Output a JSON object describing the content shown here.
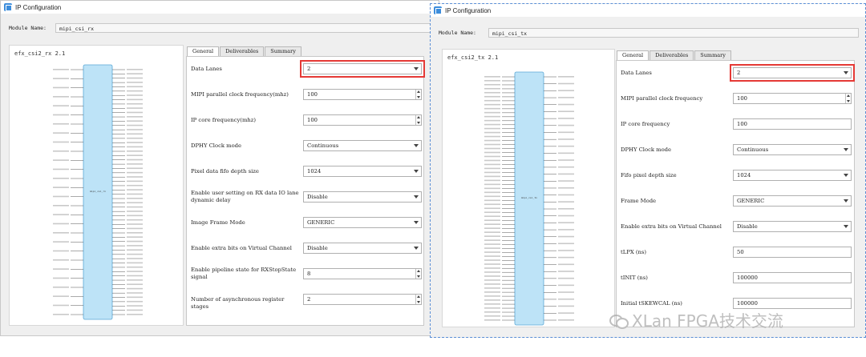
{
  "left": {
    "title": "IP Configuration",
    "module_name_label": "Module Name:",
    "module_name_value": "mipi_csi_rx",
    "symbol_title": "efx_csi2_rx 2.1",
    "block_label": "mipi_csi_rx",
    "tabs": [
      "General",
      "Deliverables",
      "Summary"
    ],
    "params": [
      {
        "label": "Data Lanes",
        "value": "2",
        "kind": "combo",
        "highlight": true
      },
      {
        "label": "MIPI parallel clock frequency(mhz)",
        "value": "100",
        "kind": "spin"
      },
      {
        "label": "IP core frequency(mhz)",
        "value": "100",
        "kind": "spin"
      },
      {
        "label": "DPHY Clock mode",
        "value": "Continuous",
        "kind": "combo"
      },
      {
        "label": "Pixel data fifo depth size",
        "value": "1024",
        "kind": "combo"
      },
      {
        "label": "Enable user setting on RX data IO lane dynamic delay",
        "value": "Disable",
        "kind": "combo"
      },
      {
        "label": "Image Frame Mode",
        "value": "GENERIC",
        "kind": "combo"
      },
      {
        "label": "Enable extra bits on Virtual Channel",
        "value": "Disable",
        "kind": "combo"
      },
      {
        "label": "Enable pipeline state for RXStopState signal",
        "value": "8",
        "kind": "spin"
      },
      {
        "label": "Number of asynchronous register stages",
        "value": "2",
        "kind": "spin"
      }
    ]
  },
  "right": {
    "title": "IP Configuration",
    "module_name_label": "Module Name:",
    "module_name_value": "mipi_csi_tx",
    "symbol_title": "efx_csi2_tx 2.1",
    "block_label": "mipi_csi_tx",
    "tabs": [
      "General",
      "Deliverables",
      "Summary"
    ],
    "params": [
      {
        "label": "Data Lanes",
        "value": "2",
        "kind": "combo",
        "highlight": true
      },
      {
        "label": "MIPI parallel clock frequency",
        "value": "100",
        "kind": "spin"
      },
      {
        "label": "IP core frequency",
        "value": "100",
        "kind": "text"
      },
      {
        "label": "DPHY Clock mode",
        "value": "Continuous",
        "kind": "combo"
      },
      {
        "label": "Fifo pixel depth size",
        "value": "1024",
        "kind": "combo"
      },
      {
        "label": "Frame Mode",
        "value": "GENERIC",
        "kind": "combo"
      },
      {
        "label": "Enable extra bits on Virtual Channel",
        "value": "Disable",
        "kind": "combo"
      },
      {
        "label": "tLPX (ns)",
        "value": "50",
        "kind": "text"
      },
      {
        "label": "tINIT (ns)",
        "value": "100000",
        "kind": "text"
      },
      {
        "label": "Initial tSKEWCAL (ns)",
        "value": "100000",
        "kind": "text"
      }
    ]
  },
  "watermark": {
    "text": "XLan FPGA技术交流"
  },
  "colors": {
    "highlight": "#e53935",
    "block_fill": "#bde3f7",
    "block_stroke": "#5aa7d6"
  }
}
